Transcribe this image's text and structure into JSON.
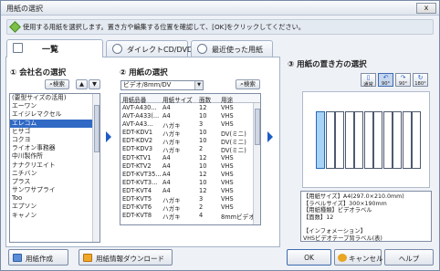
{
  "window": {
    "title": "用紙の選択",
    "close_label": "x"
  },
  "instruction": "使用する用紙を選択します。置き方や編集する位置を確認して、[OK]をクリックしてください。",
  "tabs": [
    {
      "label": "一覧"
    },
    {
      "label": "ダイレクトCD/DVD"
    },
    {
      "label": "最近使った用紙"
    }
  ],
  "section1": {
    "title": "① 会社名の選択",
    "search_label": "検索",
    "up_glyph": "▲",
    "down_glyph": "▼",
    "makers": [
      "(要型サイズの活用)",
      "エーワン",
      "エイジレマクセル",
      "エレコム",
      "ヒサゴ",
      "コクヨ",
      "ライオン事務器",
      "中川製作所",
      "ナナクリエイト",
      "ニチバン",
      "プラス",
      "サンワサプライ",
      "Too",
      "エプソン",
      "キャノン"
    ],
    "selected_index": 3
  },
  "section2": {
    "title": "② 用紙の選択",
    "combo_value": "ビデオ/8mm/DV",
    "combo_arrow": "▼",
    "search_label": "検索",
    "columns": [
      "用紙品番",
      "用紙サイズ",
      "面数",
      "用途"
    ],
    "rows": [
      [
        "AVT-A430...",
        "A4",
        "12",
        "VHS"
      ],
      [
        "AVT-A433(...",
        "A4",
        "10",
        "VHS"
      ],
      [
        "AVT-A43...",
        "ハガキ",
        "3",
        "VHS"
      ],
      [
        "EDT-KDV1",
        "ハガキ",
        "10",
        "DV(ミニ)"
      ],
      [
        "EDT-KDV2",
        "ハガキ",
        "10",
        "DV(ミニ)"
      ],
      [
        "EDT-KDV3",
        "ハガキ",
        "2",
        "DV(ミニ)"
      ],
      [
        "EDT-KTV1",
        "A4",
        "12",
        "VHS"
      ],
      [
        "EDT-KTV2",
        "A4",
        "10",
        "VHS"
      ],
      [
        "EDT-KVT35...",
        "A4",
        "12",
        "VHS"
      ],
      [
        "EDT-KVT3...",
        "A4",
        "10",
        "VHS"
      ],
      [
        "EDT-KVT4",
        "A4",
        "12",
        "VHS"
      ],
      [
        "EDT-KVT5",
        "ハガキ",
        "3",
        "VHS"
      ],
      [
        "EDT-KVT6",
        "ハガキ",
        "2",
        "VHS"
      ],
      [
        "EDT-KVT8",
        "ハガキ",
        "4",
        "8mmビデオ"
      ]
    ]
  },
  "section3": {
    "title": "③ 用紙の置き方の選択",
    "orientations": [
      {
        "label": "通常",
        "glyph": "▯"
      },
      {
        "label": "90°",
        "glyph": "↶"
      },
      {
        "label": "90°",
        "glyph": "↷"
      },
      {
        "label": "180°",
        "glyph": "↻"
      }
    ],
    "selected_orientation": 1,
    "sheet_count": 11,
    "info_lines": [
      "【用紙サイズ】A4(297.0×210.0mm)",
      "【ラベルサイズ】300×190mm",
      "【用紙種類】ビデオラベル",
      "【面数】12",
      "",
      "【インフォメーション】",
      "VHSビデオテープ背ラベル(表)"
    ]
  },
  "footer": {
    "create_label": "用紙作成",
    "download_label": "用紙情報ダウンロード",
    "ok_label": "OK",
    "cancel_label": "キャンセル",
    "help_label": "ヘルプ"
  },
  "colors": {
    "accent": "#1e5cc6",
    "selection": "#316ac5",
    "preview_highlight": "#a9d3f5"
  }
}
